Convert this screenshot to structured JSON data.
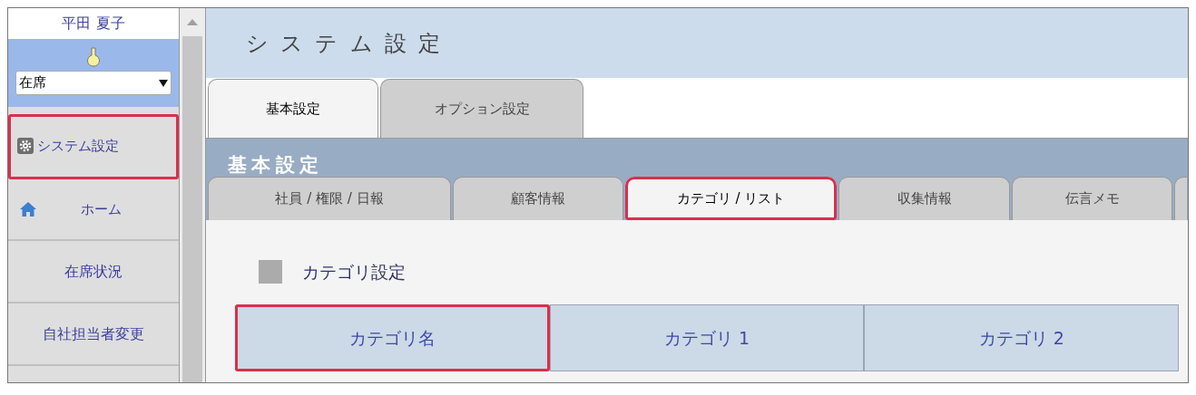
{
  "user": {
    "name": "平田 夏子"
  },
  "status_select": {
    "value": "在席"
  },
  "sidebar": {
    "items": [
      {
        "label": "システム設定",
        "kind": "gear",
        "highlighted": true
      },
      {
        "label": "ホーム",
        "kind": "home",
        "highlighted": false
      },
      {
        "label": "在席状況",
        "kind": "plain",
        "highlighted": false
      },
      {
        "label": "自社担当者変更",
        "kind": "plain",
        "highlighted": false
      }
    ]
  },
  "page": {
    "title": "システム設定"
  },
  "tabs": [
    {
      "label": "基本設定",
      "selected": true
    },
    {
      "label": "オプション設定",
      "selected": false
    }
  ],
  "section_band": {
    "title": "基本設定"
  },
  "sub_tabs": [
    {
      "label": "社員 / 権限 / 日報",
      "selected": false,
      "highlighted": false
    },
    {
      "label": "顧客情報",
      "selected": false,
      "highlighted": false
    },
    {
      "label": "カテゴリ / リスト",
      "selected": true,
      "highlighted": true
    },
    {
      "label": "収集情報",
      "selected": false,
      "highlighted": false
    },
    {
      "label": "伝言メモ",
      "selected": false,
      "highlighted": false
    }
  ],
  "section": {
    "heading": "カテゴリ設定"
  },
  "table": {
    "columns": [
      {
        "label": "カテゴリ名",
        "highlighted": true
      },
      {
        "label": "カテゴリ 1",
        "highlighted": false
      },
      {
        "label": "カテゴリ 2",
        "highlighted": false
      }
    ]
  }
}
